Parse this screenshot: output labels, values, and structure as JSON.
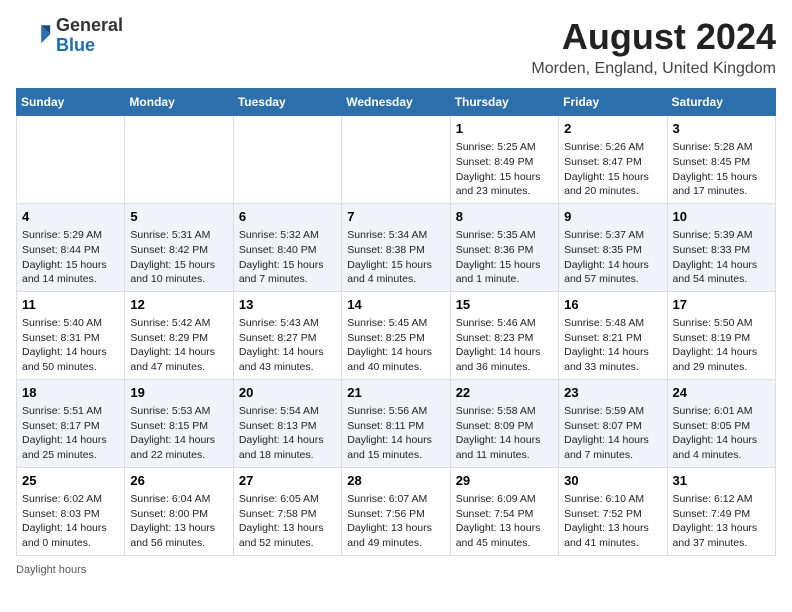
{
  "header": {
    "logo_line1": "General",
    "logo_line2": "Blue",
    "title": "August 2024",
    "subtitle": "Morden, England, United Kingdom"
  },
  "days_of_week": [
    "Sunday",
    "Monday",
    "Tuesday",
    "Wednesday",
    "Thursday",
    "Friday",
    "Saturday"
  ],
  "weeks": [
    [
      {
        "num": "",
        "info": ""
      },
      {
        "num": "",
        "info": ""
      },
      {
        "num": "",
        "info": ""
      },
      {
        "num": "",
        "info": ""
      },
      {
        "num": "1",
        "info": "Sunrise: 5:25 AM\nSunset: 8:49 PM\nDaylight: 15 hours\nand 23 minutes."
      },
      {
        "num": "2",
        "info": "Sunrise: 5:26 AM\nSunset: 8:47 PM\nDaylight: 15 hours\nand 20 minutes."
      },
      {
        "num": "3",
        "info": "Sunrise: 5:28 AM\nSunset: 8:45 PM\nDaylight: 15 hours\nand 17 minutes."
      }
    ],
    [
      {
        "num": "4",
        "info": "Sunrise: 5:29 AM\nSunset: 8:44 PM\nDaylight: 15 hours\nand 14 minutes."
      },
      {
        "num": "5",
        "info": "Sunrise: 5:31 AM\nSunset: 8:42 PM\nDaylight: 15 hours\nand 10 minutes."
      },
      {
        "num": "6",
        "info": "Sunrise: 5:32 AM\nSunset: 8:40 PM\nDaylight: 15 hours\nand 7 minutes."
      },
      {
        "num": "7",
        "info": "Sunrise: 5:34 AM\nSunset: 8:38 PM\nDaylight: 15 hours\nand 4 minutes."
      },
      {
        "num": "8",
        "info": "Sunrise: 5:35 AM\nSunset: 8:36 PM\nDaylight: 15 hours\nand 1 minute."
      },
      {
        "num": "9",
        "info": "Sunrise: 5:37 AM\nSunset: 8:35 PM\nDaylight: 14 hours\nand 57 minutes."
      },
      {
        "num": "10",
        "info": "Sunrise: 5:39 AM\nSunset: 8:33 PM\nDaylight: 14 hours\nand 54 minutes."
      }
    ],
    [
      {
        "num": "11",
        "info": "Sunrise: 5:40 AM\nSunset: 8:31 PM\nDaylight: 14 hours\nand 50 minutes."
      },
      {
        "num": "12",
        "info": "Sunrise: 5:42 AM\nSunset: 8:29 PM\nDaylight: 14 hours\nand 47 minutes."
      },
      {
        "num": "13",
        "info": "Sunrise: 5:43 AM\nSunset: 8:27 PM\nDaylight: 14 hours\nand 43 minutes."
      },
      {
        "num": "14",
        "info": "Sunrise: 5:45 AM\nSunset: 8:25 PM\nDaylight: 14 hours\nand 40 minutes."
      },
      {
        "num": "15",
        "info": "Sunrise: 5:46 AM\nSunset: 8:23 PM\nDaylight: 14 hours\nand 36 minutes."
      },
      {
        "num": "16",
        "info": "Sunrise: 5:48 AM\nSunset: 8:21 PM\nDaylight: 14 hours\nand 33 minutes."
      },
      {
        "num": "17",
        "info": "Sunrise: 5:50 AM\nSunset: 8:19 PM\nDaylight: 14 hours\nand 29 minutes."
      }
    ],
    [
      {
        "num": "18",
        "info": "Sunrise: 5:51 AM\nSunset: 8:17 PM\nDaylight: 14 hours\nand 25 minutes."
      },
      {
        "num": "19",
        "info": "Sunrise: 5:53 AM\nSunset: 8:15 PM\nDaylight: 14 hours\nand 22 minutes."
      },
      {
        "num": "20",
        "info": "Sunrise: 5:54 AM\nSunset: 8:13 PM\nDaylight: 14 hours\nand 18 minutes."
      },
      {
        "num": "21",
        "info": "Sunrise: 5:56 AM\nSunset: 8:11 PM\nDaylight: 14 hours\nand 15 minutes."
      },
      {
        "num": "22",
        "info": "Sunrise: 5:58 AM\nSunset: 8:09 PM\nDaylight: 14 hours\nand 11 minutes."
      },
      {
        "num": "23",
        "info": "Sunrise: 5:59 AM\nSunset: 8:07 PM\nDaylight: 14 hours\nand 7 minutes."
      },
      {
        "num": "24",
        "info": "Sunrise: 6:01 AM\nSunset: 8:05 PM\nDaylight: 14 hours\nand 4 minutes."
      }
    ],
    [
      {
        "num": "25",
        "info": "Sunrise: 6:02 AM\nSunset: 8:03 PM\nDaylight: 14 hours\nand 0 minutes."
      },
      {
        "num": "26",
        "info": "Sunrise: 6:04 AM\nSunset: 8:00 PM\nDaylight: 13 hours\nand 56 minutes."
      },
      {
        "num": "27",
        "info": "Sunrise: 6:05 AM\nSunset: 7:58 PM\nDaylight: 13 hours\nand 52 minutes."
      },
      {
        "num": "28",
        "info": "Sunrise: 6:07 AM\nSunset: 7:56 PM\nDaylight: 13 hours\nand 49 minutes."
      },
      {
        "num": "29",
        "info": "Sunrise: 6:09 AM\nSunset: 7:54 PM\nDaylight: 13 hours\nand 45 minutes."
      },
      {
        "num": "30",
        "info": "Sunrise: 6:10 AM\nSunset: 7:52 PM\nDaylight: 13 hours\nand 41 minutes."
      },
      {
        "num": "31",
        "info": "Sunrise: 6:12 AM\nSunset: 7:49 PM\nDaylight: 13 hours\nand 37 minutes."
      }
    ]
  ],
  "footer": {
    "note": "Daylight hours"
  }
}
